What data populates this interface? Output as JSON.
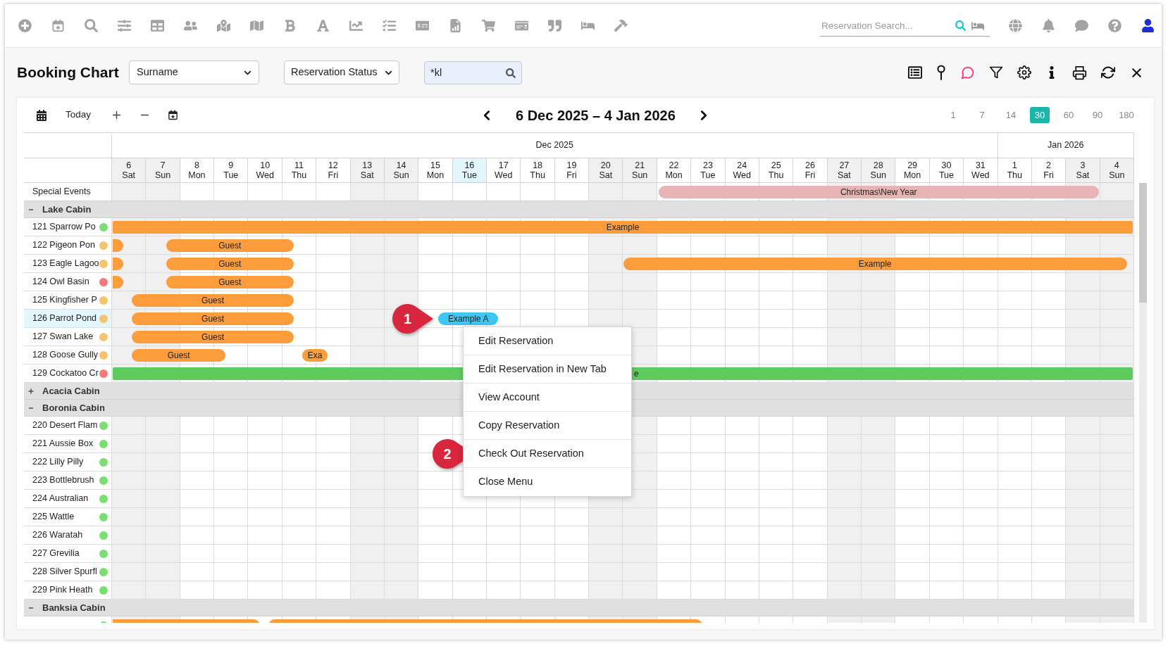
{
  "top_bar": {
    "search": {
      "placeholder": "Reservation Search..."
    }
  },
  "header": {
    "title": "Booking Chart",
    "sort_by": {
      "value": "Surname"
    },
    "status_filter": {
      "value": "Reservation Status"
    },
    "quick_filter": {
      "value": "*kl"
    }
  },
  "chart_toolbar": {
    "today_button": "Today",
    "range_title": "6 Dec 2025 – 4 Jan 2026",
    "day_spans": [
      {
        "label": "1",
        "selected": false
      },
      {
        "label": "7",
        "selected": false
      },
      {
        "label": "14",
        "selected": false
      },
      {
        "label": "30",
        "selected": true
      },
      {
        "label": "60",
        "selected": false
      },
      {
        "label": "90",
        "selected": false
      },
      {
        "label": "180",
        "selected": false
      }
    ]
  },
  "calendar": {
    "months": [
      {
        "label": "Dec 2025",
        "days": [
          {
            "day": "6",
            "weekday": "Sat",
            "weekend": true,
            "today": false
          },
          {
            "day": "7",
            "weekday": "Sun",
            "weekend": true,
            "today": false
          },
          {
            "day": "8",
            "weekday": "Mon",
            "weekend": false,
            "today": false
          },
          {
            "day": "9",
            "weekday": "Tue",
            "weekend": false,
            "today": false
          },
          {
            "day": "10",
            "weekday": "Wed",
            "weekend": false,
            "today": false
          },
          {
            "day": "11",
            "weekday": "Thu",
            "weekend": false,
            "today": false
          },
          {
            "day": "12",
            "weekday": "Fri",
            "weekend": false,
            "today": false
          },
          {
            "day": "13",
            "weekday": "Sat",
            "weekend": true,
            "today": false
          },
          {
            "day": "14",
            "weekday": "Sun",
            "weekend": true,
            "today": false
          },
          {
            "day": "15",
            "weekday": "Mon",
            "weekend": false,
            "today": false
          },
          {
            "day": "16",
            "weekday": "Tue",
            "weekend": false,
            "today": true
          },
          {
            "day": "17",
            "weekday": "Wed",
            "weekend": false,
            "today": false
          },
          {
            "day": "18",
            "weekday": "Thu",
            "weekend": false,
            "today": false
          },
          {
            "day": "19",
            "weekday": "Fri",
            "weekend": false,
            "today": false
          },
          {
            "day": "20",
            "weekday": "Sat",
            "weekend": true,
            "today": false
          },
          {
            "day": "21",
            "weekday": "Sun",
            "weekend": true,
            "today": false
          },
          {
            "day": "22",
            "weekday": "Mon",
            "weekend": false,
            "today": false
          },
          {
            "day": "23",
            "weekday": "Tue",
            "weekend": false,
            "today": false
          },
          {
            "day": "24",
            "weekday": "Wed",
            "weekend": false,
            "today": false
          },
          {
            "day": "25",
            "weekday": "Thu",
            "weekend": false,
            "today": false
          },
          {
            "day": "26",
            "weekday": "Fri",
            "weekend": false,
            "today": false
          },
          {
            "day": "27",
            "weekday": "Sat",
            "weekend": true,
            "today": false
          },
          {
            "day": "28",
            "weekday": "Sun",
            "weekend": true,
            "today": false
          },
          {
            "day": "29",
            "weekday": "Mon",
            "weekend": false,
            "today": false
          },
          {
            "day": "30",
            "weekday": "Tue",
            "weekend": false,
            "today": false
          },
          {
            "day": "31",
            "weekday": "Wed",
            "weekend": false,
            "today": false
          }
        ]
      },
      {
        "label": "Jan 2026",
        "days": [
          {
            "day": "1",
            "weekday": "Thu",
            "weekend": false,
            "today": false
          },
          {
            "day": "2",
            "weekday": "Fri",
            "weekend": false,
            "today": false
          },
          {
            "day": "3",
            "weekday": "Sat",
            "weekend": true,
            "today": false
          },
          {
            "day": "4",
            "weekday": "Sun",
            "weekend": true,
            "today": false
          }
        ]
      }
    ]
  },
  "special_events": {
    "label": "Special Events",
    "events": [
      {
        "label": "Christmas\\New Year"
      }
    ]
  },
  "groups": [
    {
      "name": "Lake Cabin",
      "expanded": true,
      "rooms": [
        {
          "name": "121 Sparrow Po",
          "color": "#77e070",
          "selected": false,
          "bookings": [
            {
              "label": "Example",
              "from_earlier": true,
              "to_later": true,
              "color": "#fd9c3a"
            }
          ]
        },
        {
          "name": "122 Pigeon Pon",
          "color": "#f5c36e",
          "selected": false,
          "bookings": [
            {
              "from_earlier": true,
              "to_later": false,
              "color": "#fd9c3a"
            },
            {
              "label": "Guest",
              "from_earlier": false,
              "to_later": false,
              "color": "#fd9c3a"
            }
          ]
        },
        {
          "name": "123 Eagle Lagoo",
          "color": "#f5c36e",
          "selected": false,
          "bookings": [
            {
              "from_earlier": true,
              "to_later": false,
              "color": "#fd9c3a"
            },
            {
              "label": "Guest",
              "from_earlier": false,
              "to_later": false,
              "color": "#fd9c3a"
            },
            {
              "label": "Example",
              "from_earlier": false,
              "to_later": false,
              "color": "#fd9c3a"
            }
          ]
        },
        {
          "name": "124 Owl Basin",
          "color": "#f47a7a",
          "selected": false,
          "bookings": [
            {
              "from_earlier": true,
              "to_later": false,
              "color": "#fd9c3a"
            },
            {
              "label": "Guest",
              "from_earlier": false,
              "to_later": false,
              "color": "#fd9c3a"
            }
          ]
        },
        {
          "name": "125 Kingfisher P",
          "color": "#f5c36e",
          "selected": false,
          "bookings": [
            {
              "label": "Guest",
              "from_earlier": false,
              "to_later": false,
              "color": "#fd9c3a"
            }
          ]
        },
        {
          "name": "126 Parrot Pond",
          "color": "#f5c36e",
          "selected": true,
          "bookings": [
            {
              "label": "Guest",
              "from_earlier": false,
              "to_later": false,
              "color": "#fd9c3a"
            },
            {
              "label": "Example A",
              "from_earlier": false,
              "to_later": false,
              "color": "#3ec6f2",
              "callout": "1"
            }
          ]
        },
        {
          "name": "127 Swan Lake",
          "color": "#f5c36e",
          "selected": false,
          "bookings": [
            {
              "label": "Guest",
              "from_earlier": false,
              "to_later": false,
              "color": "#fd9c3a"
            }
          ]
        },
        {
          "name": "128 Goose Gully",
          "color": "#f5c36e",
          "selected": false,
          "bookings": [
            {
              "label": "Guest",
              "from_earlier": false,
              "to_later": false,
              "color": "#fd9c3a"
            },
            {
              "label": "Exa",
              "from_earlier": false,
              "to_later": false,
              "color": "#fd9c3a"
            }
          ]
        },
        {
          "name": "129 Cockatoo Cr",
          "color": "#f47a7a",
          "selected": false,
          "bookings": [
            {
              "label": "e",
              "from_earlier": true,
              "to_later": true,
              "color": "#5ecb5e"
            }
          ]
        }
      ]
    },
    {
      "name": "Acacia Cabin",
      "expanded": false
    },
    {
      "name": "Boronia Cabin",
      "expanded": true,
      "rooms": [
        {
          "name": "220 Desert Flam",
          "color": "#77e070",
          "selected": false
        },
        {
          "name": "221 Aussie Box",
          "color": "#77e070",
          "selected": false
        },
        {
          "name": "222 Lilly Pilly",
          "color": "#77e070",
          "selected": false
        },
        {
          "name": "223 Bottlebrush",
          "color": "#77e070",
          "selected": false
        },
        {
          "name": "224 Australian",
          "color": "#77e070",
          "selected": false
        },
        {
          "name": "225 Wattle",
          "color": "#77e070",
          "selected": false
        },
        {
          "name": "226 Waratah",
          "color": "#77e070",
          "selected": false
        },
        {
          "name": "227 Grevilia",
          "color": "#77e070",
          "selected": false
        },
        {
          "name": "228 Silver Spurfl",
          "color": "#77e070",
          "selected": false
        },
        {
          "name": "229 Pink Heath",
          "color": "#77e070",
          "selected": false
        }
      ]
    },
    {
      "name": "Banksia Cabin",
      "expanded": true,
      "rooms": [
        {
          "color": "#77e070",
          "selected": false,
          "bookings": [
            {
              "from_earlier": true,
              "to_later": false,
              "color": "#fd9c3a"
            },
            {
              "from_earlier": false,
              "to_later": false,
              "color": "#fd9c3a"
            }
          ]
        }
      ]
    }
  ],
  "context_menu": {
    "items": [
      {
        "label": "Edit Reservation"
      },
      {
        "label": "Edit Reservation in New Tab"
      },
      {
        "label": "View Account"
      },
      {
        "label": "Copy Reservation"
      },
      {
        "label": "Check Out Reservation",
        "callout": "2"
      },
      {
        "label": "Close Menu"
      }
    ]
  }
}
